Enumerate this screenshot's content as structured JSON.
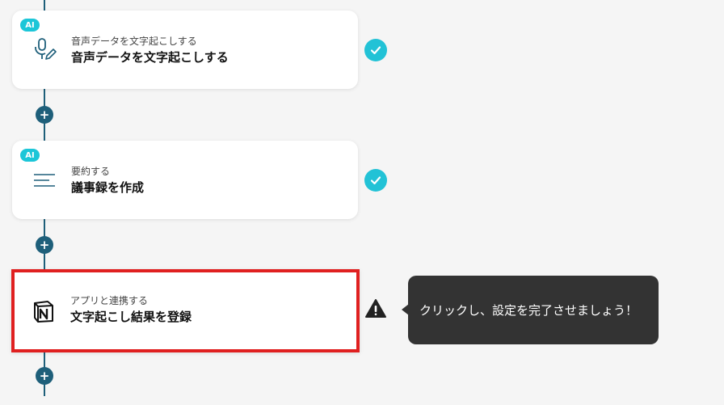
{
  "steps": [
    {
      "badge": "AI",
      "subtitle": "音声データを文字起こしする",
      "title": "音声データを文字起こしする",
      "icon": "microphone-pen-icon",
      "status": "complete"
    },
    {
      "badge": "AI",
      "subtitle": "要約する",
      "title": "議事録を作成",
      "icon": "summary-lines-icon",
      "status": "complete"
    },
    {
      "badge": "",
      "subtitle": "アプリと連携する",
      "title": "文字起こし結果を登録",
      "icon": "notion-logo-icon",
      "status": "warning"
    }
  ],
  "add_step_label": "+",
  "tooltip": {
    "text": "クリックし、設定を完了させましょう！"
  },
  "colors": {
    "connector": "#1e5f7a",
    "ai_badge": "#1cc6d8",
    "check": "#22c2d6",
    "highlight_border": "#e02020",
    "tooltip_bg": "#333333"
  }
}
